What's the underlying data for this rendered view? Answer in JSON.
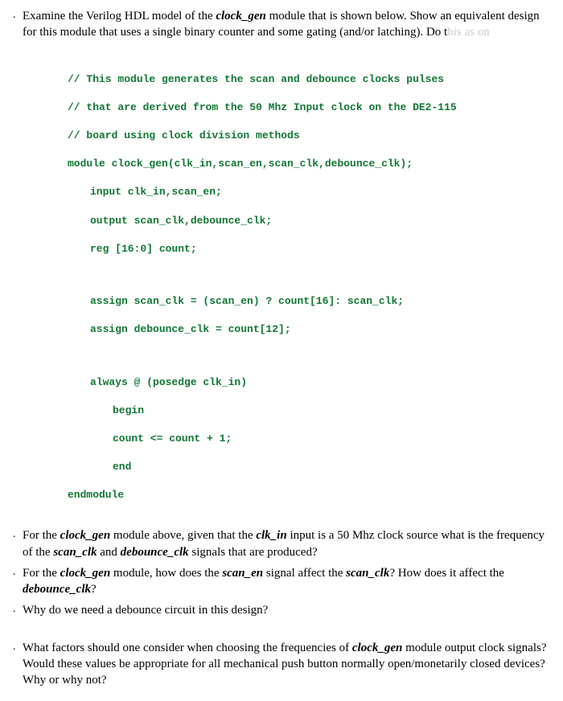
{
  "q1": {
    "bullet": ".",
    "text_parts": [
      "Examine the Verilog HDL model of the ",
      "clock_gen",
      " module that is shown below. Show an equivalent design for this module that uses a single binary counter and some gating (and/or latching). Do t",
      "his as on"
    ]
  },
  "code": {
    "l1": "// This module generates the scan and debounce clocks pulses",
    "l2": "// that are derived from the 50 Mhz Input clock on the DE2-115",
    "l3": "// board using clock division methods",
    "l4": "module clock_gen(clk_in,scan_en,scan_clk,debounce_clk);",
    "l5": "input clk_in,scan_en;",
    "l6": "output scan_clk,debounce_clk;",
    "l7": "reg [16:0] count;",
    "l8": "assign scan_clk = (scan_en) ? count[16]: scan_clk;",
    "l9": "assign debounce_clk = count[12];",
    "l10": "always @ (posedge clk_in)",
    "l11": "begin",
    "l12": "count <= count + 1;",
    "l13": "end",
    "l14": "endmodule"
  },
  "q2": {
    "bullet": ".",
    "p1": "For the ",
    "p2": "clock_gen",
    "p3": " module above, given that the ",
    "p4": "clk_in",
    "p5": " input is a 50 Mhz clock source what is the frequency of the ",
    "p6": "scan_clk",
    "p7": " and ",
    "p8": "debounce_clk",
    "p9": " signals that are produced?"
  },
  "q3": {
    "bullet": ".",
    "p1": "For the ",
    "p2": "clock_gen",
    "p3": " module, how does the ",
    "p4": "scan_en",
    "p5": " signal affect the ",
    "p6": "scan_clk",
    "p7": "? How does it affect the ",
    "p8": "debounce_clk",
    "p9": "?"
  },
  "q4": {
    "bullet": ".",
    "p1": "Why do we need a debounce circuit in this design?"
  },
  "q5": {
    "bullet": ".",
    "p1": "What factors should one consider when choosing the frequencies of ",
    "p2": "clock_gen",
    "p3": " module output clock signals? Would these values be appropriate for all mechanical push button normally open/monetarily closed devices? Why or why not?"
  }
}
